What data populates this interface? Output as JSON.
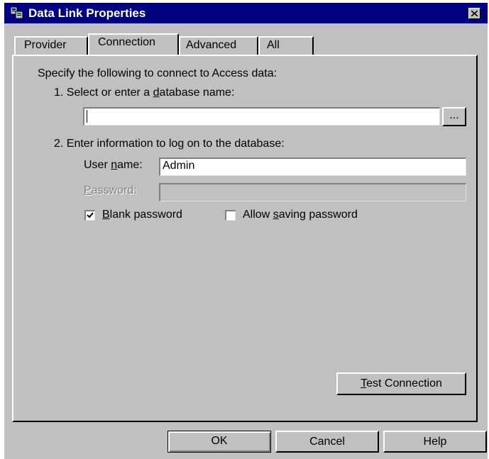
{
  "window": {
    "title": "Data Link Properties"
  },
  "tabs": [
    "Provider",
    "Connection",
    "Advanced",
    "All"
  ],
  "active_tab": "Connection",
  "connection": {
    "intro": "Specify the following to connect to Access data:",
    "step1": {
      "pre": "1. Select or enter a ",
      "ul": "d",
      "post": "atabase name:"
    },
    "database_name": "",
    "browse_label": "...",
    "step2": "2. Enter information to log on to the database:",
    "user_label": {
      "pre": "User ",
      "ul": "n",
      "post": "ame:"
    },
    "user_name": "Admin",
    "password_label": {
      "ul": "P",
      "post": "assword:"
    },
    "password": "",
    "blank_password": {
      "ul": "B",
      "post": "lank password",
      "checked": true
    },
    "allow_saving": {
      "pre": "Allow ",
      "ul": "s",
      "post": "aving password",
      "checked": false
    },
    "test_connection": {
      "ul": "T",
      "post": "est Connection"
    }
  },
  "buttons": {
    "ok": "OK",
    "cancel": "Cancel",
    "help": "Help"
  }
}
